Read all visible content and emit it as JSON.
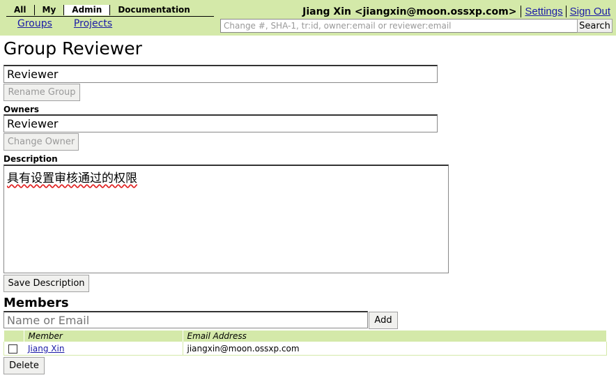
{
  "nav": {
    "main_menu": [
      "All",
      "My",
      "Admin",
      "Documentation"
    ],
    "active_menu": "Admin",
    "sub_menu": [
      "Groups",
      "Projects"
    ]
  },
  "user": {
    "display": "Jiang Xin <jiangxin@moon.ossxp.com>",
    "settings_label": "Settings",
    "signout_label": "Sign Out"
  },
  "search": {
    "placeholder": "Change #, SHA-1, tr:id, owner:email or reviewer:email",
    "button_label": "Search"
  },
  "page": {
    "title": "Group Reviewer"
  },
  "group_name": {
    "value": "Reviewer",
    "rename_label": "Rename Group"
  },
  "owners": {
    "label": "Owners",
    "value": "Reviewer",
    "change_label": "Change Owner"
  },
  "description": {
    "label": "Description",
    "value": "具有设置审核通过的权限",
    "save_label": "Save Description"
  },
  "members": {
    "heading": "Members",
    "input_placeholder": "Name or Email",
    "add_label": "Add",
    "columns": [
      "Member",
      "Email Address"
    ],
    "rows": [
      {
        "name": "Jiang Xin",
        "email": "jiangxin@moon.ossxp.com",
        "checked": false
      }
    ],
    "delete_label": "Delete"
  },
  "colors": {
    "header_bg": "#d4e9a9",
    "link": "#1a1aa6"
  }
}
